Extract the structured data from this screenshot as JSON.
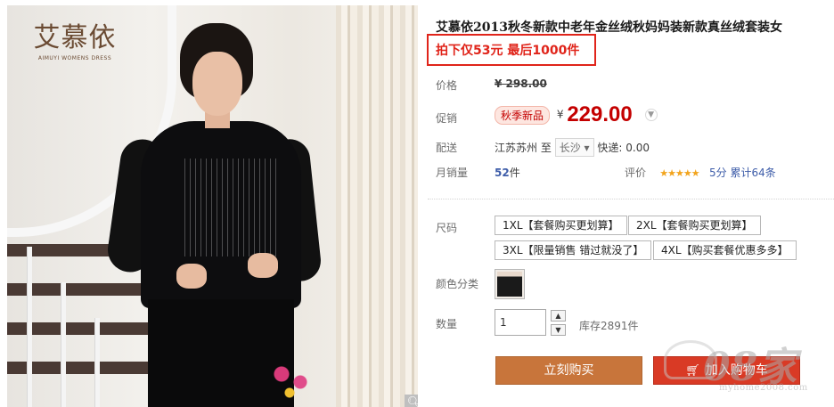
{
  "image": {
    "brand_logo": "艾慕依",
    "brand_sub": "AIMUYI WOMENS DRESS",
    "zoom_icon": "magnifier-icon"
  },
  "product": {
    "title": "艾慕依2013秋冬新款中老年金丝绒秋妈妈装新款真丝绒套装女",
    "promo": "拍下仅53元 最后1000件"
  },
  "info": {
    "price_label": "价格",
    "original_price": "¥ 298.00",
    "promo_label": "促销",
    "promo_badge": "秋季新品",
    "currency": "¥",
    "price": "229.00",
    "shipping_label": "配送",
    "ship_from": "江苏苏州",
    "to": "至",
    "ship_to": "长沙",
    "express": "快递: 0.00",
    "sales_label": "月销量",
    "sales_count": "52",
    "sales_unit": "件",
    "rating_label": "评价",
    "stars": "★★★★★",
    "score": "5分",
    "reviews": "累计64条"
  },
  "sku": {
    "size_label": "尺码",
    "sizes": [
      "1XL【套餐购买更划算】",
      "2XL【套餐购买更划算】",
      "3XL【限量销售 错过就没了】",
      "4XL【购买套餐优惠多多】"
    ],
    "color_label": "颜色分类",
    "qty_label": "数量",
    "qty_value": "1",
    "stock": "库存2891件"
  },
  "actions": {
    "buy_now": "立刻购买",
    "add_cart": "加入购物车"
  },
  "watermark": {
    "text": "08家",
    "url": "myhome2008.com"
  },
  "colors": {
    "accent_red": "#c40000",
    "promo_red": "#e0241a",
    "buy_orange": "#c8753b",
    "cart_red": "#d93a25",
    "link_blue": "#3e5da9",
    "star_gold": "#f2a41d"
  }
}
